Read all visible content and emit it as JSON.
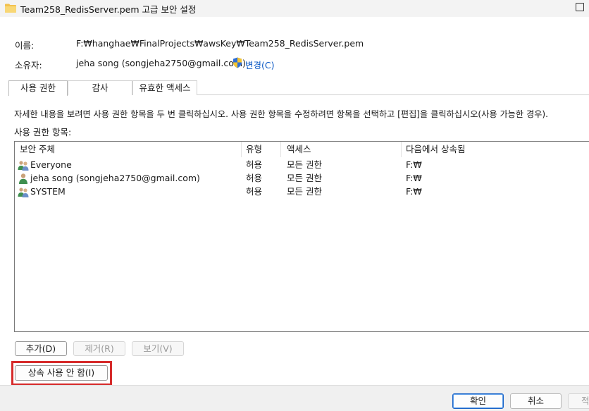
{
  "window": {
    "title": "Team258_RedisServer.pem 고급 보안 설정"
  },
  "file": {
    "name_label": "이름:",
    "name_value": "F:₩hanghae₩FinalProjects₩awsKey₩Team258_RedisServer.pem",
    "owner_label": "소유자:",
    "owner_value": "jeha song (songjeha2750@gmail.com)",
    "change_link": "변경(C)"
  },
  "tabs": [
    {
      "label": "사용 권한"
    },
    {
      "label": "감사"
    },
    {
      "label": "유효한 액세스"
    }
  ],
  "permissions": {
    "info_text": "자세한 내용을 보려면 사용 권한 항목을 두 번 클릭하십시오. 사용 권한 항목을 수정하려면 항목을 선택하고 [편집]을 클릭하십시오(사용 가능한 경우).",
    "entries_label": "사용 권한 항목:",
    "columns": [
      "보안 주체",
      "유형",
      "액세스",
      "다음에서 상속됨"
    ],
    "rows": [
      {
        "principal": "Everyone",
        "type": "허용",
        "access": "모든 권한",
        "inherited": "F:₩",
        "icon": "group-icon"
      },
      {
        "principal": "jeha song (songjeha2750@gmail.com)",
        "type": "허용",
        "access": "모든 권한",
        "inherited": "F:₩",
        "icon": "user-icon"
      },
      {
        "principal": "SYSTEM",
        "type": "허용",
        "access": "모든 권한",
        "inherited": "F:₩",
        "icon": "group-icon"
      }
    ]
  },
  "buttons": {
    "add": "추가(D)",
    "remove": "제거(R)",
    "view": "보기(V)",
    "disable_inheritance": "상속 사용 안 함(I)",
    "ok": "확인",
    "cancel": "취소",
    "apply": "적"
  },
  "colors": {
    "link": "#0a58c4",
    "highlight": "#d62b2b",
    "default_button_border": "#1a64c8"
  }
}
